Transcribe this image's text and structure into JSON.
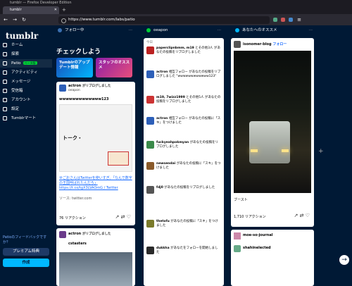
{
  "browser": {
    "window_title": "tumblr — Firefox Developer Edition",
    "tab_title": "tumblr",
    "url": "https://www.tumblr.com/labs/patio"
  },
  "sidebar": {
    "logo": "tumblr",
    "items": [
      {
        "label": "ホーム",
        "icon": "home-icon"
      },
      {
        "label": "探索",
        "icon": "compass-icon"
      },
      {
        "label": "Patio",
        "icon": "grid-icon",
        "badge": "ベータ版"
      },
      {
        "label": "アクティビティ",
        "icon": "lightning-icon"
      },
      {
        "label": "メッセージ",
        "icon": "chat-icon"
      },
      {
        "label": "受信箱",
        "icon": "inbox-icon"
      },
      {
        "label": "アカウント",
        "icon": "user-icon"
      },
      {
        "label": "設定",
        "icon": "gear-icon"
      },
      {
        "label": "Tumblrマート",
        "icon": "shop-icon"
      }
    ],
    "feedback": "Patioのフィードバックですか？",
    "premium": "プレミアム特典",
    "post": "作成"
  },
  "columns": {
    "following": {
      "title": "フォロー中",
      "check_title": "チェックしよう",
      "tile1": "Tumblrのアップデート情報",
      "tile2": "スタッフのオススメ",
      "post1": {
        "user": "actron",
        "action": "がリブログしました",
        "source": "oeapon",
        "headline": "wwwwwwwwwwwww123",
        "body": "せごおさんはTwitterを使いすぎ。「なんで数字の王国呼ばれたんだろ」https://t.co/tgX3LVAOmG / Twitter",
        "source_line": "ソース: twitter.com",
        "reactions": "76 リアクション"
      },
      "post2": {
        "user": "actron",
        "action": "がリブログしました",
        "reblogged_from": "cstasters"
      }
    },
    "oeapon": {
      "title": "oeapon",
      "date_today": "今日",
      "notifications": [
        {
          "user": "paperclipnbmm, m19",
          "text": "とその他3人 があなたの投稿をリブログしました"
        },
        {
          "user": "actron",
          "text": "相互フォロー があなたの投稿をリブログしました \"wwwwwwwwwwww123\""
        },
        {
          "user": "m19, 7wizz1999",
          "text": "とその他5人 があなたの投稿をリブログしました"
        },
        {
          "user": "actron",
          "text": "相互フォロー があなたの投稿に「スキ」をつけました"
        },
        {
          "user": "fuckyeahpokmyan",
          "text": "があなたの投稿をリブログしました"
        },
        {
          "user": "newsendai",
          "text": "があなたの投稿に「スキ」をつけました"
        },
        {
          "user": "fdj0",
          "text": "があなたの投稿をリブログしました"
        },
        {
          "user": "thetofu",
          "text": "があなたの投稿に「スキ」をつけました"
        },
        {
          "user": "dukkha",
          "text": "があなたをフォローを開始しました"
        }
      ]
    },
    "recommended": {
      "title": "あなたへのオススメ",
      "blog": "isonomer-blog",
      "follow": "フォロー",
      "boost": "ブースト",
      "reactions": "1,710 リアクション",
      "next_blog": "moe-so-journal",
      "next_user": "shahinelected"
    }
  },
  "colors": {
    "bg": "#001935",
    "accent": "#00b8ff",
    "green": "#00cf35",
    "link": "#1a6cff"
  }
}
